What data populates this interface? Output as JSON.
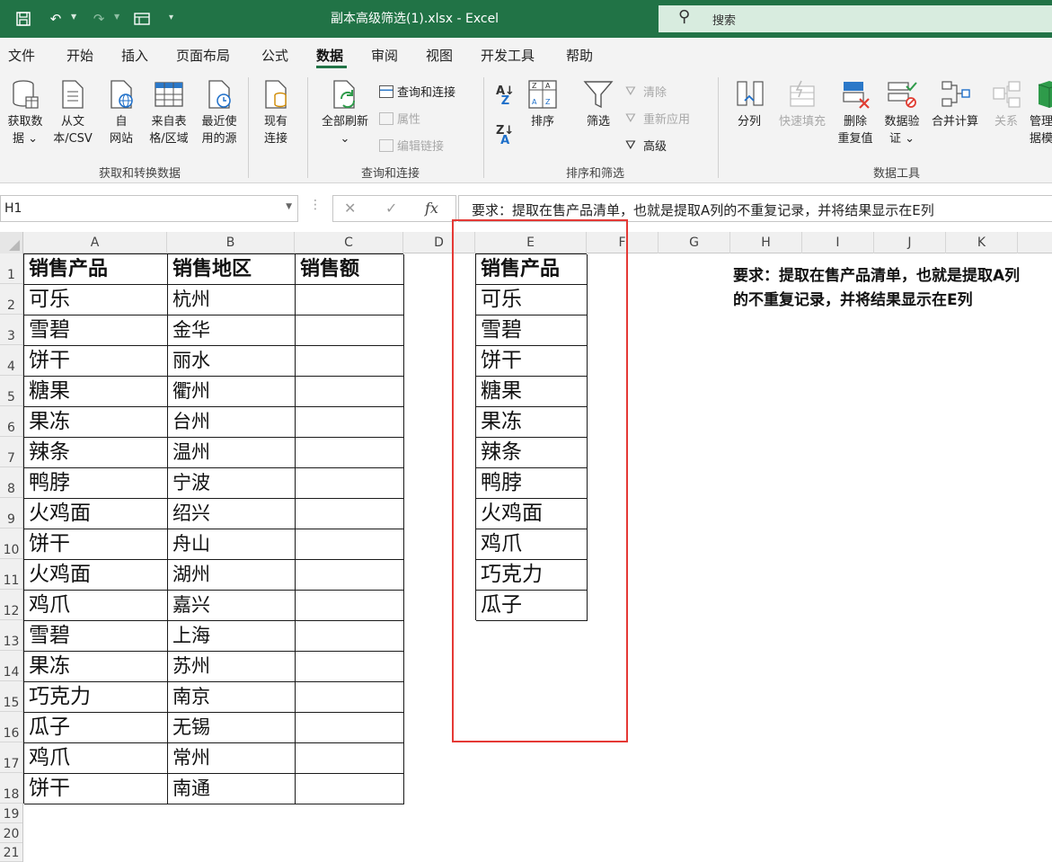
{
  "title_bar": {
    "filename": "副本高级筛选(1).xlsx  -  Excel",
    "search_placeholder": "搜索"
  },
  "ribbon_tabs": [
    "文件",
    "开始",
    "插入",
    "页面布局",
    "公式",
    "数据",
    "审阅",
    "视图",
    "开发工具",
    "帮助"
  ],
  "active_tab": "数据",
  "ribbon": {
    "groups": {
      "get_transform": "获取和转换数据",
      "queries": "查询和连接",
      "sort_filter": "排序和筛选",
      "data_tools": "数据工具"
    },
    "buttons": {
      "get_data": [
        "获取数",
        "据 ⌄"
      ],
      "from_csv": [
        "从文",
        "本/CSV"
      ],
      "from_web": [
        "自",
        "网站"
      ],
      "from_table": [
        "来自表",
        "格/区域"
      ],
      "recent_sources": [
        "最近使",
        "用的源"
      ],
      "existing_connections": [
        "现有",
        "连接"
      ],
      "refresh_all": [
        "全部刷新",
        "⌄"
      ],
      "queries_connections": "查询和连接",
      "properties": "属性",
      "edit_links": "编辑链接",
      "sort": "排序",
      "filter": "筛选",
      "clear": "清除",
      "reapply": "重新应用",
      "advanced": "高级",
      "text_to_columns": "分列",
      "flash_fill": "快速填充",
      "remove_duplicates": [
        "删除",
        "重复值"
      ],
      "data_validation": [
        "数据验",
        "证 ⌄"
      ],
      "consolidate": "合并计算",
      "relationships": "关系",
      "manage_data_model": [
        "管理",
        "据模"
      ]
    }
  },
  "formula_bar": {
    "name_box": "H1",
    "formula": "要求：提取在售产品清单，也就是提取A列的不重复记录，并将结果显示在E列"
  },
  "columns": [
    "A",
    "B",
    "C",
    "D",
    "E",
    "F",
    "G",
    "H",
    "I",
    "J",
    "K"
  ],
  "rows": [
    "1",
    "2",
    "3",
    "4",
    "5",
    "6",
    "7",
    "8",
    "9",
    "10",
    "11",
    "12",
    "13",
    "14",
    "15",
    "16",
    "17",
    "18",
    "19",
    "20",
    "21"
  ],
  "table_a": {
    "headers": [
      "销售产品",
      "销售地区",
      "销售额"
    ],
    "rows": [
      [
        "可乐",
        "杭州",
        ""
      ],
      [
        "雪碧",
        "金华",
        ""
      ],
      [
        "饼干",
        "丽水",
        ""
      ],
      [
        "糖果",
        "衢州",
        ""
      ],
      [
        "果冻",
        "台州",
        ""
      ],
      [
        "辣条",
        "温州",
        ""
      ],
      [
        "鸭脖",
        "宁波",
        ""
      ],
      [
        "火鸡面",
        "绍兴",
        ""
      ],
      [
        "饼干",
        "舟山",
        ""
      ],
      [
        "火鸡面",
        "湖州",
        ""
      ],
      [
        "鸡爪",
        "嘉兴",
        ""
      ],
      [
        "雪碧",
        "上海",
        ""
      ],
      [
        "果冻",
        "苏州",
        ""
      ],
      [
        "巧克力",
        "南京",
        ""
      ],
      [
        "瓜子",
        "无锡",
        ""
      ],
      [
        "鸡爪",
        "常州",
        ""
      ],
      [
        "饼干",
        "南通",
        ""
      ]
    ]
  },
  "table_e": {
    "header": "销售产品",
    "values": [
      "可乐",
      "雪碧",
      "饼干",
      "糖果",
      "果冻",
      "辣条",
      "鸭脖",
      "火鸡面",
      "鸡爪",
      "巧克力",
      "瓜子"
    ]
  },
  "note_text": "要求：提取在售产品清单，也就是提取A列的不重复记录，并将结果显示在E列",
  "colors": {
    "excel_green": "#217346",
    "highlight_red": "#e53935"
  }
}
